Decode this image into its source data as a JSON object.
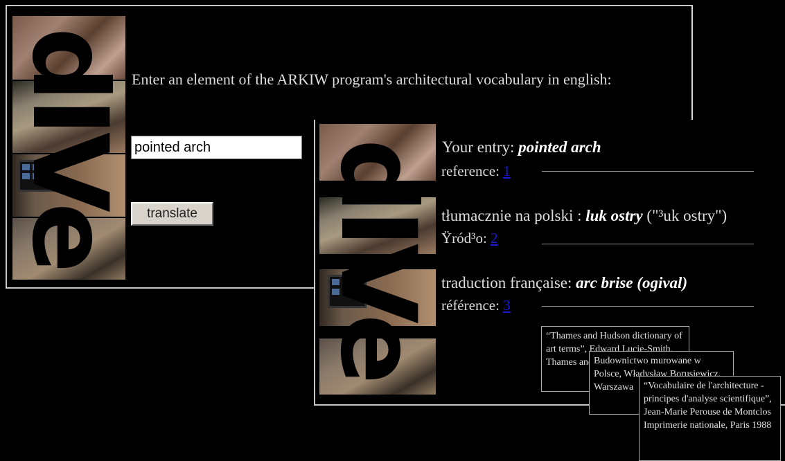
{
  "logo": {
    "text": "dIVe"
  },
  "form": {
    "prompt": "Enter an element of the ARKIW program's architectural vocabulary in english:",
    "input_value": "pointed arch",
    "translate_label": "translate"
  },
  "results": {
    "entry_label": "Your entry: ",
    "entry_value": "pointed arch",
    "ref1_label": "reference: ",
    "ref1_link": "1",
    "polish_label": "tłumacznie na polski : ",
    "polish_value": "luk ostry",
    "polish_note": "  (\"³uk ostry\")",
    "ref2_label": "Ÿród³o: ",
    "ref2_link": "2",
    "french_label": "traduction française: ",
    "french_value": "arc brise (ogival)",
    "ref3_label": "référence: ",
    "ref3_link": "3"
  },
  "tooltips": [
    {
      "text": "“Thames and Hudson dictionary of art terms”, Edward Lucie-Smith, Thames and Hudson"
    },
    {
      "text": "Budownictwo murowane w Polsce, Władysław Borusiewicz, Warszawa"
    },
    {
      "text": "“Vocabulaire de l'architecture - principes d'analyse scientifique”, Jean-Marie Perouse de Montclos Imprimerie nationale, Paris 1988"
    }
  ]
}
